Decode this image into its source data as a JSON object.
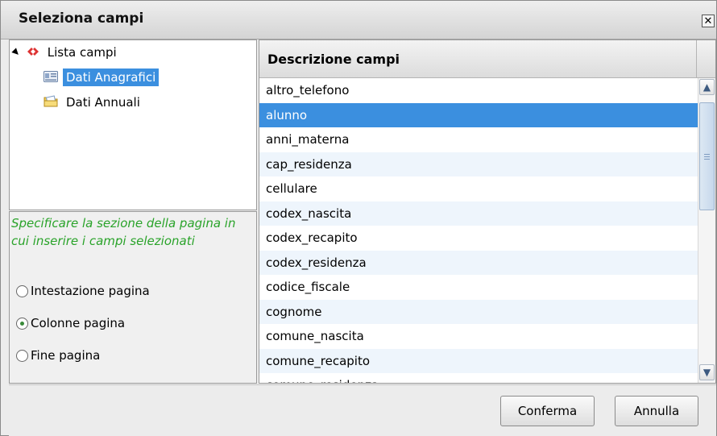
{
  "dialog": {
    "title": "Seleziona campi",
    "close_icon": "close-icon"
  },
  "tree": {
    "root": {
      "label": "Lista campi",
      "icon": "xml-tag-icon"
    },
    "items": [
      {
        "label": "Dati Anagrafici",
        "icon": "id-card-icon",
        "selected": true
      },
      {
        "label": "Dati Annuali",
        "icon": "folder-envelope-icon",
        "selected": false
      }
    ]
  },
  "options": {
    "hint": "Specificare la sezione della pagina in cui inserire i campi selezionati",
    "radios": [
      {
        "label": "Intestazione pagina",
        "checked": false
      },
      {
        "label": "Colonne pagina",
        "checked": true
      },
      {
        "label": "Fine pagina",
        "checked": false
      }
    ]
  },
  "grid": {
    "header": "Descrizione campi",
    "rows": [
      "altro_telefono",
      "alunno",
      "anni_materna",
      "cap_residenza",
      "cellulare",
      "codex_nascita",
      "codex_recapito",
      "codex_residenza",
      "codice_fiscale",
      "cognome",
      "comune_nascita",
      "comune_recapito",
      "comune_residenza"
    ],
    "selected_row": "alunno"
  },
  "footer": {
    "confirm_label": "Conferma",
    "cancel_label": "Annulla"
  },
  "colors": {
    "selection": "#3b8fdf",
    "hint_text": "#2aa32a",
    "alt_row": "#eef5fc"
  }
}
